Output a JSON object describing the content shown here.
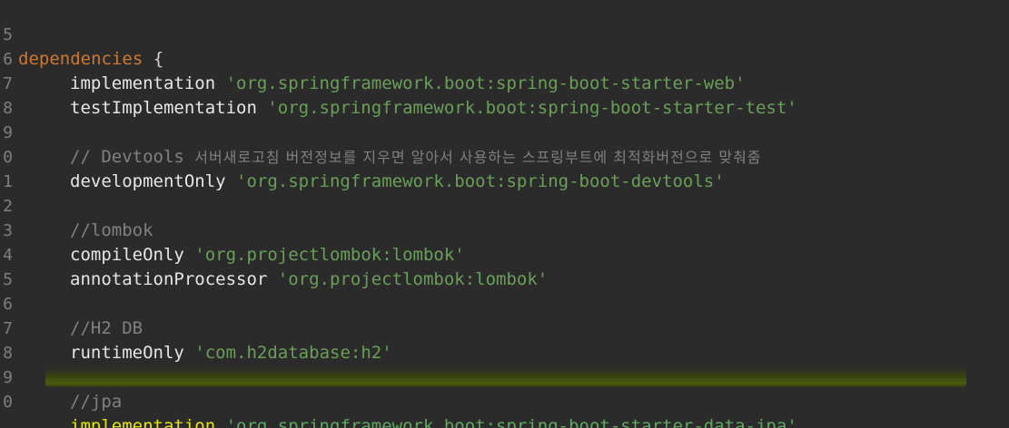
{
  "editor": {
    "lines": [
      {
        "num": "5",
        "keyword": "dependencies",
        "punct": " {"
      },
      {
        "num": "6",
        "call": "implementation",
        "string": "'org.springframework.boot:spring-boot-starter-web'"
      },
      {
        "num": "7",
        "call": "testImplementation",
        "string": "'org.springframework.boot:spring-boot-starter-test'"
      },
      {
        "num": "8"
      },
      {
        "num": "9",
        "comment_prefix": "// Devtools ",
        "comment_text": "서버새로고침 버전정보를 지우면 알아서 사용하는 스프링부트에 최적화버전으로 맞춰줌"
      },
      {
        "num": "0",
        "call": "developmentOnly",
        "string": "'org.springframework.boot:spring-boot-devtools'"
      },
      {
        "num": "1"
      },
      {
        "num": "2",
        "comment": "//lombok"
      },
      {
        "num": "3",
        "call": "compileOnly",
        "string": "'org.projectlombok:lombok'"
      },
      {
        "num": "4",
        "call": "annotationProcessor",
        "string": "'org.projectlombok:lombok'"
      },
      {
        "num": "5"
      },
      {
        "num": "6",
        "comment": "//H2 DB"
      },
      {
        "num": "7",
        "call": "runtimeOnly",
        "string": "'com.h2database:h2'"
      },
      {
        "num": "8"
      },
      {
        "num": "9",
        "comment": "//jpa"
      },
      {
        "num": "0",
        "call": "implementation",
        "string": "'org.springframework.boot:spring-boot-starter-data-jpa'"
      }
    ]
  },
  "colors": {
    "background": "#2b2b2b",
    "keyword": "#cc7832",
    "string": "#6a9f59",
    "comment": "#808080",
    "highlight": "#e5e500"
  }
}
